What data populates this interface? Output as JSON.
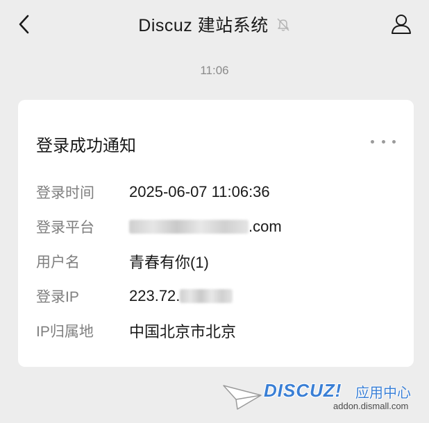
{
  "header": {
    "title": "Discuz 建站系统",
    "icons": {
      "back": "chevron-left-icon",
      "mute": "bell-off-icon",
      "profile": "user-icon"
    }
  },
  "message": {
    "time": "11:06"
  },
  "card": {
    "title": "登录成功通知",
    "more_icon": "more-dots-icon",
    "rows": [
      {
        "label": "登录时间",
        "value": "2025-06-07 11:06:36"
      },
      {
        "label": "登录平台",
        "value_suffix": ".com"
      },
      {
        "label": "用户名",
        "value": "青春有你(1)"
      },
      {
        "label": "登录IP",
        "value_prefix": "223.72."
      },
      {
        "label": "IP归属地",
        "value": "中国北京市北京"
      }
    ]
  },
  "watermark": {
    "logo": "DISCUZ!",
    "suffix": "应用中心",
    "url": "addon.dismall.com",
    "color": "#3a7fd5"
  }
}
